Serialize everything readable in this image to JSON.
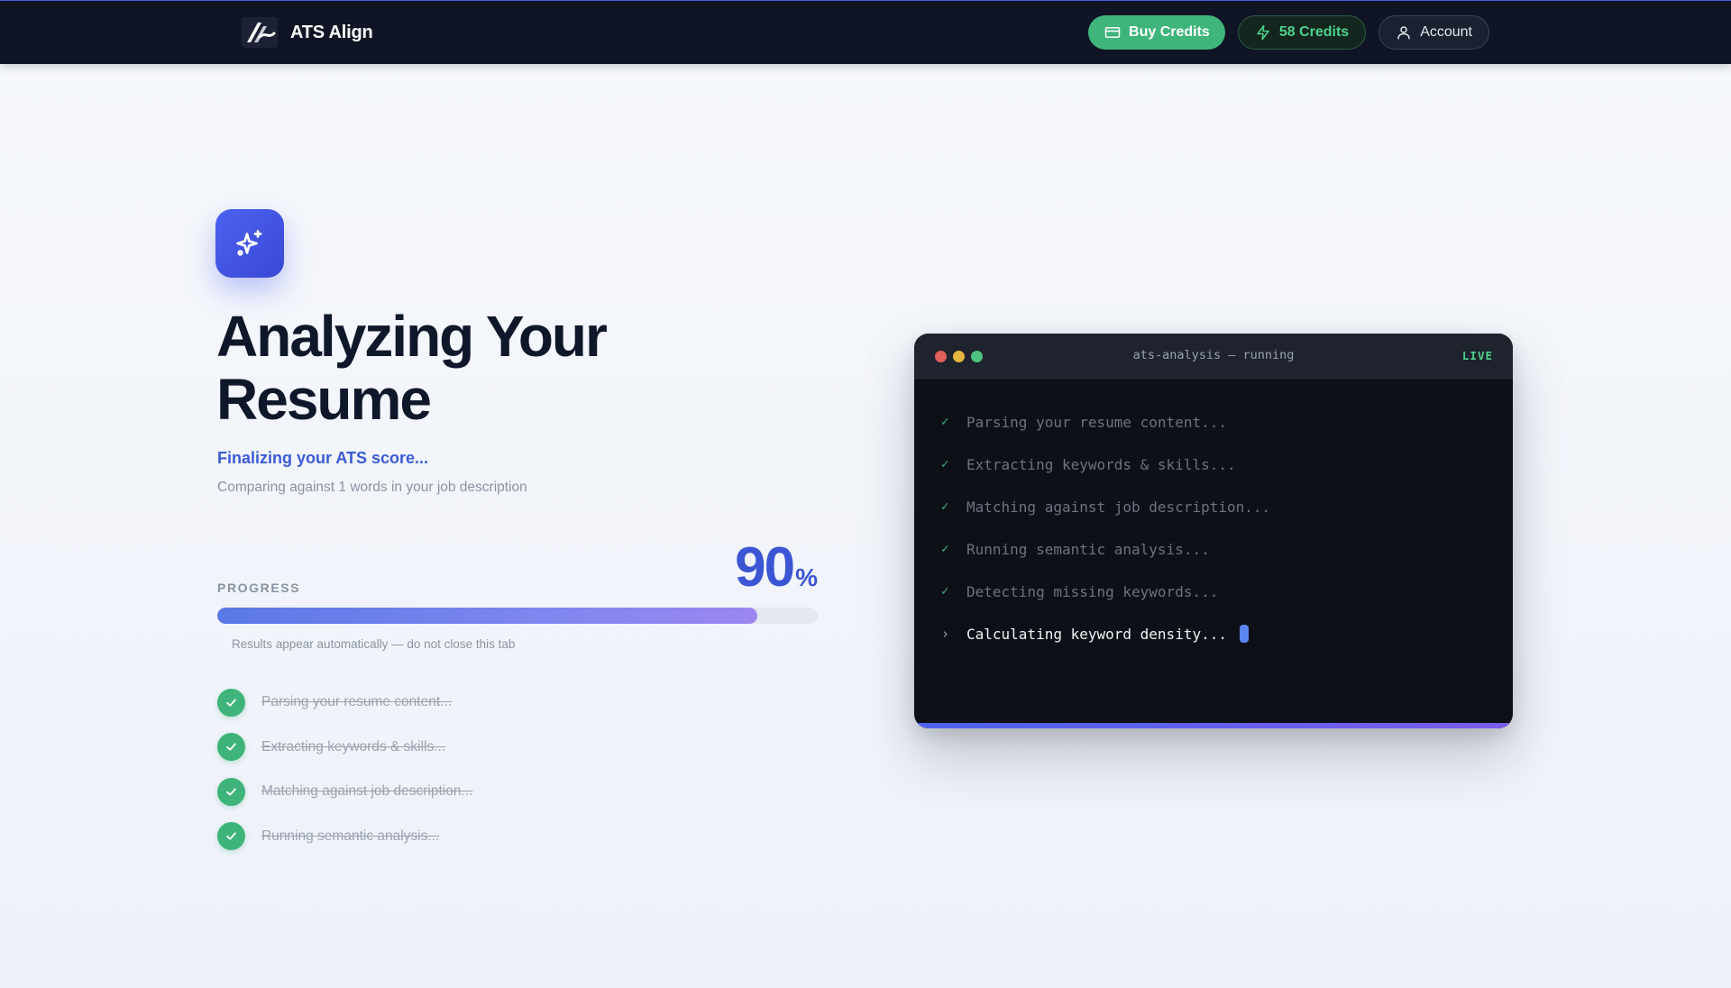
{
  "nav": {
    "brand_name": "ATS Align",
    "buy_credits_label": "Buy Credits",
    "credits_label": "58 Credits",
    "account_label": "Account"
  },
  "main": {
    "title": "Analyzing Your Resume",
    "status": "Finalizing your ATS score...",
    "subtitle": "Comparing against 1 words in your job description",
    "progress": {
      "label": "PROGRESS",
      "value": "90",
      "unit": "%",
      "fraction": 0.9,
      "note": "Results appear automatically — do not close this tab"
    },
    "steps": [
      {
        "label": "Parsing your resume content...",
        "done": true
      },
      {
        "label": "Extracting keywords & skills...",
        "done": true
      },
      {
        "label": "Matching against job description...",
        "done": true
      },
      {
        "label": "Running semantic analysis...",
        "done": true
      }
    ]
  },
  "terminal": {
    "title": "ats-analysis — running",
    "live_label": "LIVE",
    "done_mark": "✓",
    "active_mark": "›",
    "lines": [
      {
        "text": "Parsing your resume content...",
        "state": "done"
      },
      {
        "text": "Extracting keywords & skills...",
        "state": "done"
      },
      {
        "text": "Matching against job description...",
        "state": "done"
      },
      {
        "text": "Running semantic analysis...",
        "state": "done"
      },
      {
        "text": "Detecting missing keywords...",
        "state": "done"
      },
      {
        "text": "Calculating keyword density...",
        "state": "active"
      }
    ]
  },
  "colors": {
    "accent": "#3b55d4",
    "success": "#3eb47a",
    "nav_bg": "#0f1524",
    "terminal_bg": "#0d1017"
  },
  "icons": {
    "brand": "ats-align-logo",
    "hero": "sparkles-icon",
    "buy": "credit-card-icon",
    "credits": "lightning-icon",
    "account": "user-icon",
    "step": "check-icon"
  }
}
